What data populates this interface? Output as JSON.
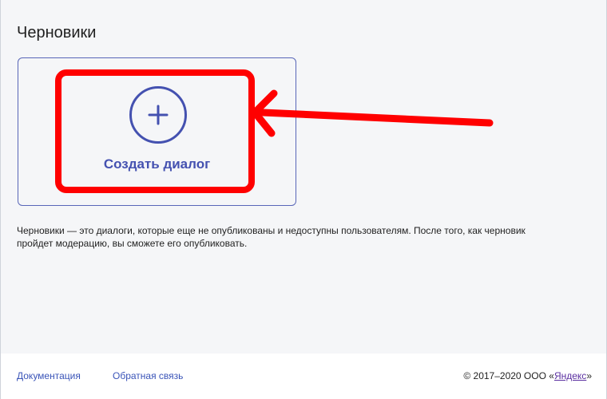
{
  "page": {
    "title": "Черновики"
  },
  "create_card": {
    "label": "Создать диалог",
    "icon": "plus-icon"
  },
  "description": "Черновики — это диалоги, которые еще не опубликованы и недоступны пользователям. После того, как черновик пройдет модерацию, вы сможете его опубликовать.",
  "footer": {
    "docs_label": "Документация",
    "feedback_label": "Обратная связь",
    "copyright_prefix": "© 2017–2020  ООО «",
    "company_link": "Яндекс",
    "copyright_suffix": "»"
  },
  "colors": {
    "accent": "#4451b0",
    "annotation": "#ff0000",
    "link": "#3a54b8",
    "visited_link": "#5a2fa0",
    "background": "#f5f6f8"
  }
}
